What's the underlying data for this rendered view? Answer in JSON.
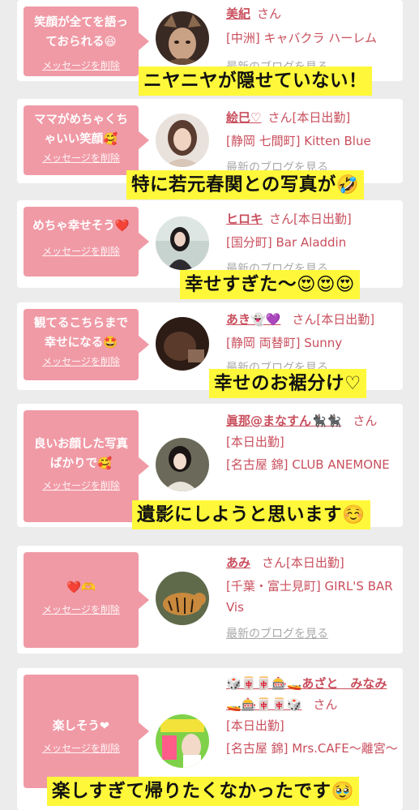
{
  "colors": {
    "page_bg": "#ececec",
    "card_bg": "#ffffff",
    "bubble_pink": "#f09aa6",
    "name_red": "#c94f5d",
    "caption_yellow": "#fff83a"
  },
  "cards": [
    {
      "message": "笑顔が全てを語っておられる😆",
      "delete_label": "メッセージを削除",
      "name": "美紀",
      "honorific": "さん",
      "status": "",
      "shop": "[中洲] キャバクラ ハーレム",
      "blog_label": "最新のブログを見る",
      "avatar_icon": "girl-with-animal-ears-photo",
      "caption": "ニヤニヤが隠せていない！"
    },
    {
      "message": "ママがめちゃくちゃいい笑顔🥰",
      "delete_label": "メッセージを削除",
      "name": "絵巳♡",
      "honorific": "さん",
      "status": "[本日出勤]",
      "shop": "[静岡 七間町] Kitten Blue",
      "blog_label": "最新のブログを見る",
      "avatar_icon": "woman-portrait-photo",
      "caption": "特に若元春関との写真が🤣"
    },
    {
      "message": "めちゃ幸せそう❤️",
      "delete_label": "メッセージを削除",
      "name": "ヒロキ",
      "honorific": "さん",
      "status": "[本日出勤]",
      "shop": "[国分町] Bar Aladdin",
      "blog_label": "最新のブログを見る",
      "avatar_icon": "woman-outdoor-photo",
      "caption": "幸せすぎた〜😍😍😍"
    },
    {
      "message": "観てるこちらまで幸せになる🤩",
      "delete_label": "メッセージを削除",
      "name": "あき👻💜",
      "honorific": "さん",
      "status": "[本日出勤]",
      "shop": "[静岡 両替町] Sunny",
      "blog_label": "最新のブログを見る",
      "avatar_icon": "dark-interior-photo",
      "caption": "幸せのお裾分け♡"
    },
    {
      "message": "良いお顔した写真ばかりで🥰",
      "delete_label": "メッセージを削除",
      "name": "眞那@まなすん🐈‍⬛🐈‍⬛",
      "honorific": "さん",
      "status": "[本日出勤]",
      "shop": "[名古屋 錦] CLUB ANEMONE",
      "blog_label": "",
      "avatar_icon": "woman-kimono-photo",
      "caption": "遺影にしようと思います☺️"
    },
    {
      "message": "❤️🫶",
      "delete_label": "メッセージを削除",
      "name": "あみ",
      "honorific": "さん",
      "status": "[本日出勤]",
      "shop": "[千葉・富士見町] GIRL'S BAR Vis",
      "blog_label": "最新のブログを見る",
      "avatar_icon": "tiger-photo",
      "caption": ""
    },
    {
      "message": "楽しそう❤",
      "delete_label": "メッセージを削除",
      "name": "🎲🀄🀄🎰🚤あざと　みなみ🚤🎰🀄🀄🎲",
      "honorific": "さん",
      "status": "[本日出勤]",
      "shop": "[名古屋 錦] Mrs.CAFE〜離宮〜",
      "blog_label": "",
      "avatar_icon": "colorful-poster-photo",
      "caption": "楽しすぎて帰りたくなかったです🥹"
    }
  ]
}
